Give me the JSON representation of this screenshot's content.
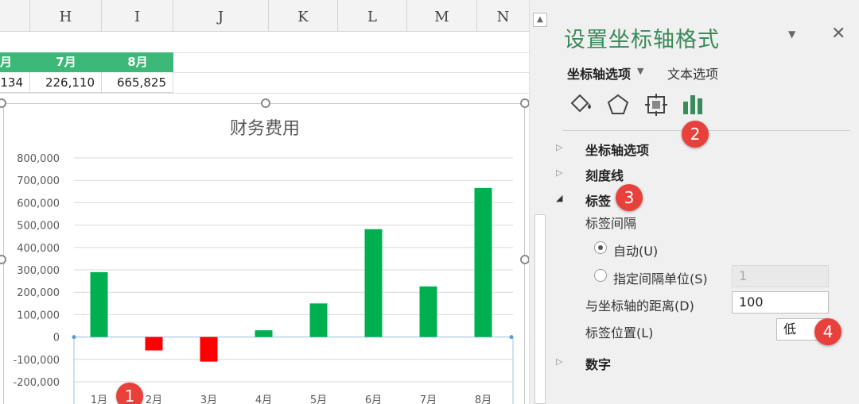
{
  "columns": [
    "H",
    "I",
    "J",
    "K",
    "L",
    "M",
    "N"
  ],
  "table": {
    "header": [
      "月",
      "7月",
      "8月"
    ],
    "values": [
      "134",
      "226,110",
      "665,825"
    ]
  },
  "chart_data": {
    "type": "bar",
    "title": "财务费用",
    "categories": [
      "1月",
      "2月",
      "3月",
      "4月",
      "5月",
      "6月",
      "7月",
      "8月"
    ],
    "values": [
      290000,
      -60000,
      -110000,
      30000,
      150000,
      482000,
      226110,
      665825
    ],
    "yticks": [
      "800,000",
      "700,000",
      "600,000",
      "500,000",
      "400,000",
      "300,000",
      "200,000",
      "100,000",
      "0",
      "-100,000",
      "-200,000"
    ],
    "ylim": [
      -300000,
      800000
    ],
    "positive_color": "#00b050",
    "negative_color": "#ff0000",
    "grid": true
  },
  "pane": {
    "title": "设置坐标轴格式",
    "dropdown_icon": "caret-down-icon",
    "close_icon": "close-icon",
    "tab_axis": "坐标轴选项",
    "tab_text": "文本选项",
    "icons": [
      "fill-line-icon",
      "effects-pentagon-icon",
      "size-properties-icon",
      "axis-options-bar-icon"
    ],
    "sections": {
      "axis_options": "坐标轴选项",
      "tick_marks": "刻度线",
      "labels": "标签",
      "number": "数字"
    },
    "label_interval": "标签间隔",
    "auto": "自动(U)",
    "specify_interval": "指定间隔单位(S)",
    "interval_value": "1",
    "distance_label": "与坐标轴的距离(D)",
    "distance_value": "100",
    "position_label": "标签位置(L)",
    "position_value": "低"
  },
  "badges": [
    "1",
    "2",
    "3",
    "4"
  ],
  "accent": "#3a8a5b",
  "table_header_color": "#3cb878",
  "badge_color": "#e8413c"
}
